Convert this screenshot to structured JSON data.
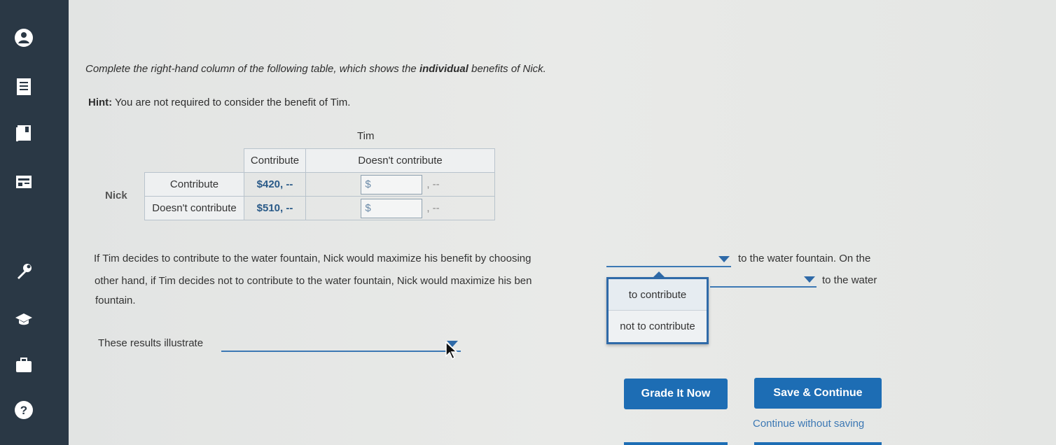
{
  "instructions": {
    "prefix": "Complete the right-hand column of the following table, which shows the ",
    "bold": "individual",
    "suffix": " benefits of Nick."
  },
  "hint": {
    "label": "Hint:",
    "text": " You are not required to consider the benefit of Tim."
  },
  "table": {
    "column_player": "Tim",
    "row_player": "Nick",
    "columns": [
      "Contribute",
      "Doesn't contribute"
    ],
    "rows": [
      {
        "label": "Contribute",
        "col1": "$420, --",
        "col2_prefix": "$",
        "col2_suffix": ", --"
      },
      {
        "label": "Doesn't contribute",
        "col1": "$510, --",
        "col2_prefix": "$",
        "col2_suffix": ", --"
      }
    ]
  },
  "paragraph": {
    "line1_start": "If Tim decides to contribute to the water fountain, Nick would maximize his benefit by choosing",
    "line1_end": "to the water fountain. On the",
    "line2_start": "other hand, if Tim decides not to contribute to the water fountain, Nick would maximize his ben",
    "line2_end": "to the water",
    "line3": "fountain."
  },
  "dropdown_menu": {
    "options": [
      "to contribute",
      "not to contribute"
    ]
  },
  "results": {
    "label": "These results illustrate"
  },
  "buttons": {
    "grade": "Grade It Now",
    "save": "Save & Continue",
    "continue_link": "Continue without saving"
  },
  "colors": {
    "sidebar": "#2a3845",
    "accent": "#1d6db4"
  }
}
